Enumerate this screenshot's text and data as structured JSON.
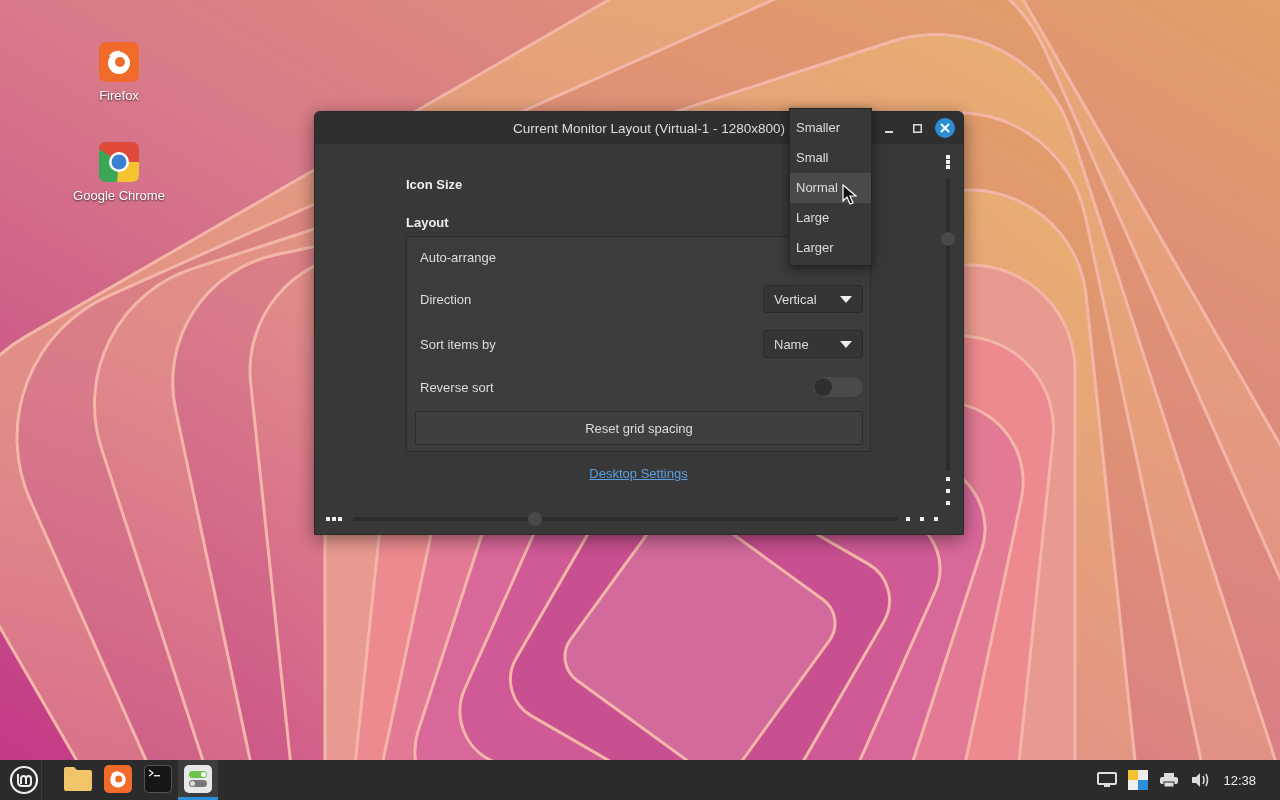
{
  "desktop_icons": [
    {
      "label": "Firefox",
      "kind": "firefox"
    },
    {
      "label": "Google Chrome",
      "kind": "chrome"
    }
  ],
  "window": {
    "title": "Current Monitor Layout (Virtual-1 - 1280x800)",
    "icon_size_label": "Icon Size",
    "layout_label": "Layout",
    "layout_rows": [
      {
        "kind": "text",
        "label": "Auto-arrange"
      },
      {
        "kind": "dropdown",
        "label": "Direction",
        "value": "Vertical"
      },
      {
        "kind": "dropdown",
        "label": "Sort items by",
        "value": "Name"
      },
      {
        "kind": "switch",
        "label": "Reverse sort",
        "on": false
      }
    ],
    "reset_button": "Reset grid spacing",
    "link": "Desktop Settings"
  },
  "icon_size_menu": [
    {
      "label": "Smaller",
      "selected": false
    },
    {
      "label": "Small",
      "selected": false
    },
    {
      "label": "Normal",
      "selected": true
    },
    {
      "label": "Large",
      "selected": false
    },
    {
      "label": "Larger",
      "selected": false
    }
  ],
  "taskbar": {
    "launchers": [
      {
        "kind": "folder",
        "active": false
      },
      {
        "kind": "firefox",
        "active": false
      },
      {
        "kind": "terminal",
        "active": false
      },
      {
        "kind": "settings",
        "active": true
      }
    ],
    "tray": [
      {
        "kind": "display"
      },
      {
        "kind": "colors"
      },
      {
        "kind": "printer"
      },
      {
        "kind": "volume"
      }
    ],
    "clock": "12:38"
  }
}
